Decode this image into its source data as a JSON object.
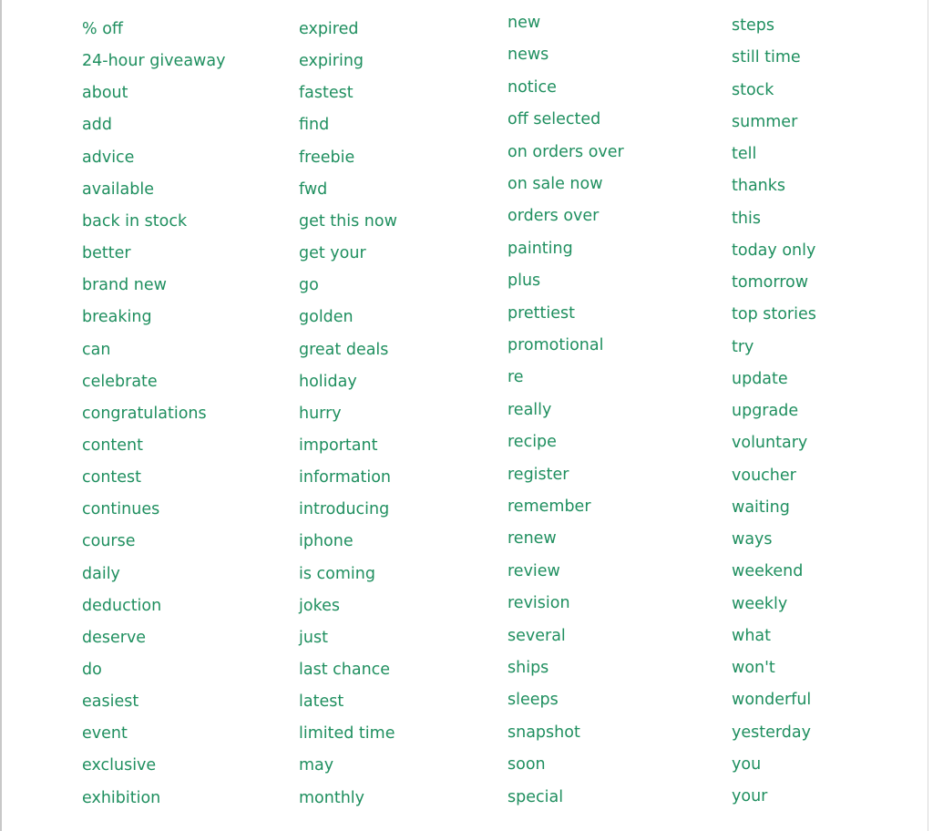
{
  "text_color": "#1f8f5f",
  "columns": [
    [
      "% off",
      "24-hour giveaway",
      "about",
      "add",
      "advice",
      "available",
      "back in stock",
      "better",
      "brand new",
      "breaking",
      "can",
      "celebrate",
      "congratulations",
      "content",
      "contest",
      "continues",
      "course",
      "daily",
      "deduction",
      "deserve",
      "do",
      "easiest",
      "event",
      "exclusive",
      "exhibition"
    ],
    [
      "expired",
      "expiring",
      "fastest",
      "find",
      "freebie",
      "fwd",
      "get this now",
      "get your",
      "go",
      "golden",
      "great deals",
      "holiday",
      "hurry",
      "important",
      "information",
      "introducing",
      "iphone",
      "is coming",
      "jokes",
      "just",
      "last chance",
      "latest",
      "limited time",
      "may",
      "monthly"
    ],
    [
      "new",
      "news",
      "notice",
      "off selected",
      "on orders over",
      "on sale now",
      "orders over",
      "painting",
      "plus",
      "prettiest",
      "promotional",
      "re",
      "really",
      "recipe",
      "register",
      "remember",
      "renew",
      "review",
      "revision",
      "several",
      "ships",
      "sleeps",
      "snapshot",
      "soon",
      "special"
    ],
    [
      "steps",
      "still time",
      "stock",
      "summer",
      "tell",
      "thanks",
      "this",
      "today only",
      "tomorrow",
      "top stories",
      "try",
      "update",
      "upgrade",
      "voluntary",
      "voucher",
      "waiting",
      "ways",
      "weekend",
      "weekly",
      "what",
      "won't",
      "wonderful",
      "yesterday",
      "you",
      "your"
    ]
  ]
}
